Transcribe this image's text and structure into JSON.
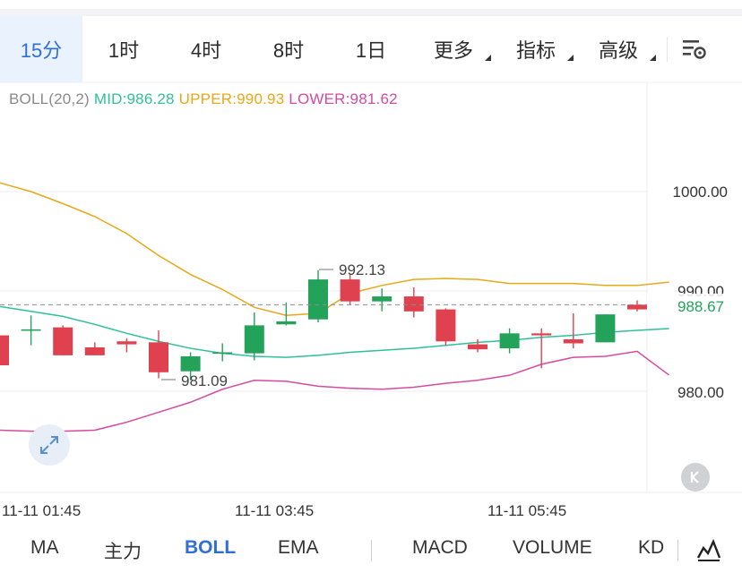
{
  "tabs": [
    {
      "label": "15分",
      "active": true
    },
    {
      "label": "1时",
      "active": false
    },
    {
      "label": "4时",
      "active": false
    },
    {
      "label": "8时",
      "active": false
    },
    {
      "label": "1日",
      "active": false
    },
    {
      "label": "更多",
      "active": false,
      "dropdown": true
    },
    {
      "label": "指标",
      "active": false,
      "dropdown": true
    },
    {
      "label": "高级",
      "active": false,
      "dropdown": true
    }
  ],
  "settings_icon": "chart-settings-icon",
  "indicator": {
    "name": "BOLL(20,2)",
    "mid_label": "MID:986.28",
    "upper_label": "UPPER:990.93",
    "lower_label": "LOWER:981.62"
  },
  "colors": {
    "accent": "#2f6fd6",
    "up": "#23a35a",
    "down": "#e0414f",
    "mid": "#2fbf9a",
    "upper": "#e8a817",
    "lower": "#d64aa0"
  },
  "price_labels": {
    "p1000": "1000.00",
    "p990": "990.00",
    "p980": "980.00",
    "current": "988.67"
  },
  "annotations": {
    "high": "992.13",
    "low": "981.09"
  },
  "time_labels": [
    "11-11 01:45",
    "11-11 03:45",
    "11-11 05:45"
  ],
  "chart_data": {
    "type": "candlestick",
    "ylim": [
      975.5,
      1004.5
    ],
    "candles": [
      {
        "o": 985.6,
        "c": 982.6,
        "h": 986.0,
        "l": 982.3
      },
      {
        "o": 986.2,
        "c": 986.2,
        "h": 987.6,
        "l": 984.6
      },
      {
        "o": 986.4,
        "c": 983.6,
        "h": 986.6,
        "l": 983.6
      },
      {
        "o": 984.4,
        "c": 983.6,
        "h": 984.9,
        "l": 983.6
      },
      {
        "o": 985.0,
        "c": 984.7,
        "h": 985.3,
        "l": 983.9
      },
      {
        "o": 984.9,
        "c": 981.9,
        "h": 986.1,
        "l": 981.3
      },
      {
        "o": 982.0,
        "c": 983.5,
        "h": 983.9,
        "l": 981.1
      },
      {
        "o": 983.9,
        "c": 983.9,
        "h": 984.8,
        "l": 983.0
      },
      {
        "o": 983.8,
        "c": 986.6,
        "h": 987.9,
        "l": 983.1
      },
      {
        "o": 986.7,
        "c": 987.0,
        "h": 988.9,
        "l": 986.6
      },
      {
        "o": 987.2,
        "c": 991.2,
        "h": 992.13,
        "l": 986.9
      },
      {
        "o": 991.2,
        "c": 989.0,
        "h": 991.8,
        "l": 988.7
      },
      {
        "o": 989.0,
        "c": 989.5,
        "h": 990.3,
        "l": 988.0
      },
      {
        "o": 989.5,
        "c": 988.0,
        "h": 990.4,
        "l": 987.4
      },
      {
        "o": 988.2,
        "c": 985.0,
        "h": 988.3,
        "l": 984.6
      },
      {
        "o": 984.7,
        "c": 984.2,
        "h": 985.2,
        "l": 983.9
      },
      {
        "o": 984.3,
        "c": 985.8,
        "h": 986.3,
        "l": 983.8
      },
      {
        "o": 985.8,
        "c": 985.6,
        "h": 986.3,
        "l": 982.3
      },
      {
        "o": 985.2,
        "c": 984.8,
        "h": 987.8,
        "l": 984.3
      },
      {
        "o": 984.9,
        "c": 987.7,
        "h": 987.7,
        "l": 984.9
      },
      {
        "o": 988.67,
        "c": 988.2,
        "h": 989.1,
        "l": 988.0
      },
      {
        "o": 988.2,
        "c": 988.67,
        "h": 989.3,
        "l": 987.9
      }
    ],
    "mid": [
      988.5,
      988.0,
      987.5,
      986.7,
      985.8,
      985.0,
      984.3,
      983.8,
      983.5,
      983.4,
      983.6,
      983.9,
      984.1,
      984.3,
      984.6,
      984.9,
      985.1,
      985.4,
      985.6,
      985.9,
      986.1,
      986.28
    ],
    "upper": [
      1000.9,
      1000.0,
      998.8,
      997.5,
      995.8,
      993.6,
      991.7,
      990.2,
      988.4,
      987.6,
      987.8,
      989.8,
      990.6,
      991.2,
      991.3,
      991.2,
      990.8,
      990.8,
      990.8,
      990.6,
      990.6,
      990.93
    ],
    "lower": [
      976.1,
      976.0,
      976.0,
      976.1,
      976.9,
      977.9,
      978.9,
      980.2,
      981.1,
      981.0,
      980.5,
      980.3,
      980.2,
      980.4,
      980.8,
      981.1,
      981.6,
      982.7,
      983.4,
      983.5,
      984.0,
      981.62
    ],
    "current": 988.67
  },
  "bottom_tabs": [
    {
      "label": "MA",
      "active": false
    },
    {
      "label": "主力",
      "active": false
    },
    {
      "label": "BOLL",
      "active": true
    },
    {
      "label": "EMA",
      "active": false
    },
    {
      "label": "MACD",
      "active": false
    },
    {
      "label": "VOLUME",
      "active": false
    },
    {
      "label": "KD",
      "active": false
    }
  ],
  "chart_type_icon": "line-chart-icon",
  "expand_icon": "expand-arrows-icon",
  "collapse_icon": "k-collapse-icon"
}
